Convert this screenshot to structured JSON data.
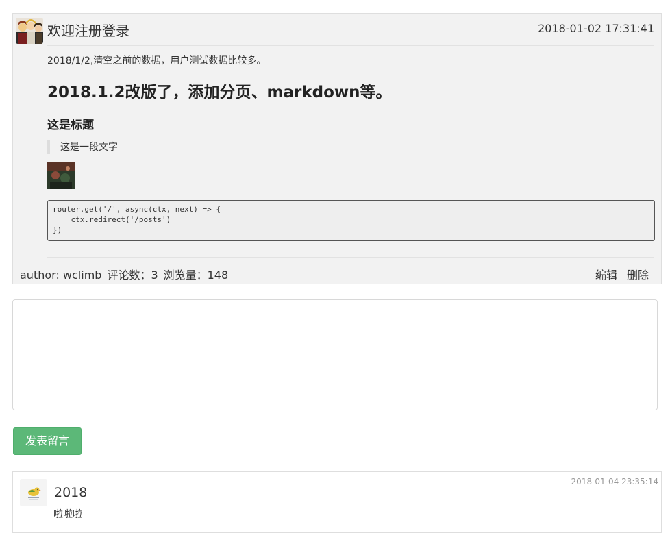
{
  "post": {
    "author_avatar_icon": "anime-group-avatar",
    "title": "欢迎注册登录",
    "date": "2018-01-02 17:31:41",
    "intro": "2018/1/2,清空之前的数据，用户测试数据比较多。",
    "heading1": "2018.1.2改版了，添加分页、markdown等。",
    "heading2": "这是标题",
    "quote": "这是一段文字",
    "image_icon": "photo-thumbnail",
    "code": "router.get('/', async(ctx, next) => {\n    ctx.redirect('/posts')\n})",
    "footer": {
      "author": "author: wclimb",
      "comments": "评论数：3",
      "views": "浏览量：148",
      "edit_label": "编辑",
      "delete_label": "删除"
    }
  },
  "comment_form": {
    "textarea_value": "",
    "submit_label": "发表留言",
    "submit_color": "#5cb878"
  },
  "comments": [
    {
      "avatar_icon": "bird-avatar",
      "author": "2018",
      "date": "2018-01-04 23:35:14",
      "text": "啦啦啦"
    }
  ]
}
